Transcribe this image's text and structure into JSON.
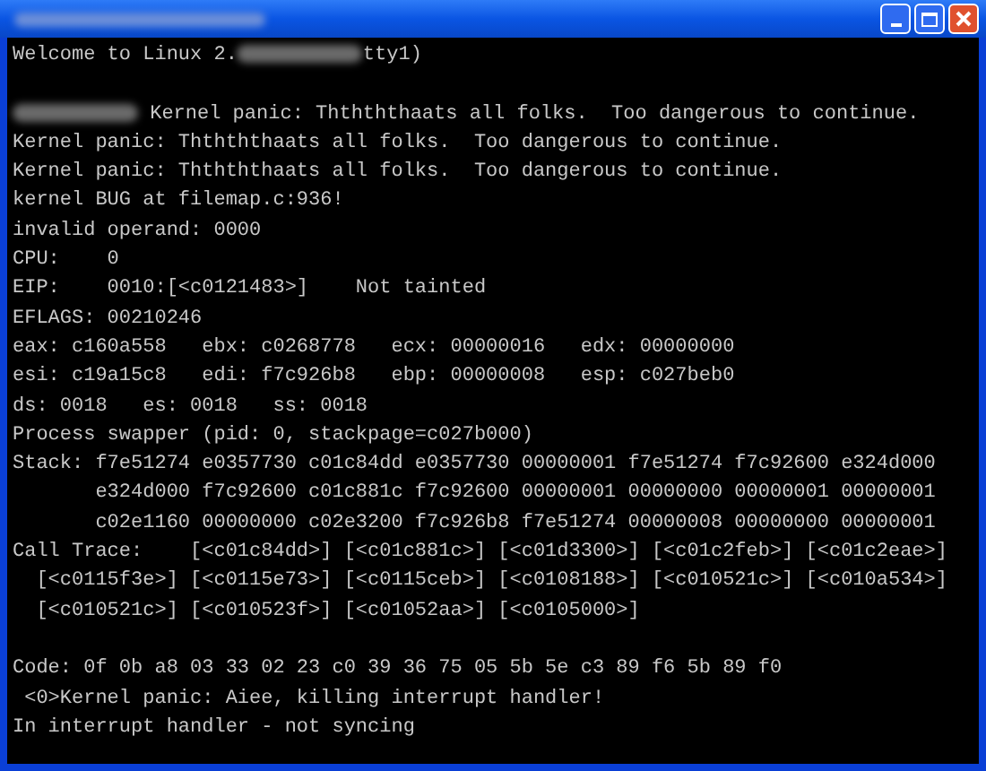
{
  "console": {
    "lines": [
      {
        "kind": "text",
        "segments": [
          {
            "kind": "text",
            "text": "Welcome to Linux 2."
          },
          {
            "kind": "blur"
          },
          {
            "kind": "text",
            "text": "tty1)"
          }
        ]
      },
      {
        "kind": "blank"
      },
      {
        "kind": "text",
        "segments": [
          {
            "kind": "blur"
          },
          {
            "kind": "text",
            "text": " Kernel panic: Ththththaats all folks.  Too dangerous to continue."
          }
        ]
      },
      {
        "kind": "text",
        "segments": [
          {
            "kind": "text",
            "text": "Kernel panic: Ththththaats all folks.  Too dangerous to continue."
          }
        ]
      },
      {
        "kind": "text",
        "segments": [
          {
            "kind": "text",
            "text": "Kernel panic: Ththththaats all folks.  Too dangerous to continue."
          }
        ]
      },
      {
        "kind": "text",
        "segments": [
          {
            "kind": "text",
            "text": "kernel BUG at filemap.c:936!"
          }
        ]
      },
      {
        "kind": "text",
        "segments": [
          {
            "kind": "text",
            "text": "invalid operand: 0000"
          }
        ]
      },
      {
        "kind": "text",
        "segments": [
          {
            "kind": "text",
            "text": "CPU:    0"
          }
        ]
      },
      {
        "kind": "text",
        "segments": [
          {
            "kind": "text",
            "text": "EIP:    0010:[<c0121483>]    Not tainted"
          }
        ]
      },
      {
        "kind": "text",
        "segments": [
          {
            "kind": "text",
            "text": "EFLAGS: 00210246"
          }
        ]
      },
      {
        "kind": "text",
        "segments": [
          {
            "kind": "text",
            "text": "eax: c160a558   ebx: c0268778   ecx: 00000016   edx: 00000000"
          }
        ]
      },
      {
        "kind": "text",
        "segments": [
          {
            "kind": "text",
            "text": "esi: c19a15c8   edi: f7c926b8   ebp: 00000008   esp: c027beb0"
          }
        ]
      },
      {
        "kind": "text",
        "segments": [
          {
            "kind": "text",
            "text": "ds: 0018   es: 0018   ss: 0018"
          }
        ]
      },
      {
        "kind": "text",
        "segments": [
          {
            "kind": "text",
            "text": "Process swapper (pid: 0, stackpage=c027b000)"
          }
        ]
      },
      {
        "kind": "text",
        "segments": [
          {
            "kind": "text",
            "text": "Stack: f7e51274 e0357730 c01c84dd e0357730 00000001 f7e51274 f7c92600 e324d000"
          }
        ]
      },
      {
        "kind": "text",
        "segments": [
          {
            "kind": "text",
            "text": "       e324d000 f7c92600 c01c881c f7c92600 00000001 00000000 00000001 00000001"
          }
        ]
      },
      {
        "kind": "text",
        "segments": [
          {
            "kind": "text",
            "text": "       c02e1160 00000000 c02e3200 f7c926b8 f7e51274 00000008 00000000 00000001"
          }
        ]
      },
      {
        "kind": "text",
        "segments": [
          {
            "kind": "text",
            "text": "Call Trace:    [<c01c84dd>] [<c01c881c>] [<c01d3300>] [<c01c2feb>] [<c01c2eae>]"
          }
        ]
      },
      {
        "kind": "text",
        "segments": [
          {
            "kind": "text",
            "text": "  [<c0115f3e>] [<c0115e73>] [<c0115ceb>] [<c0108188>] [<c010521c>] [<c010a534>]"
          }
        ]
      },
      {
        "kind": "text",
        "segments": [
          {
            "kind": "text",
            "text": "  [<c010521c>] [<c010523f>] [<c01052aa>] [<c0105000>]"
          }
        ]
      },
      {
        "kind": "blank"
      },
      {
        "kind": "text",
        "segments": [
          {
            "kind": "text",
            "text": "Code: 0f 0b a8 03 33 02 23 c0 39 36 75 05 5b 5e c3 89 f6 5b 89 f0"
          }
        ]
      },
      {
        "kind": "text",
        "segments": [
          {
            "kind": "text",
            "text": " <0>Kernel panic: Aiee, killing interrupt handler!"
          }
        ]
      },
      {
        "kind": "text",
        "segments": [
          {
            "kind": "text",
            "text": "In interrupt handler - not syncing"
          }
        ]
      }
    ]
  }
}
